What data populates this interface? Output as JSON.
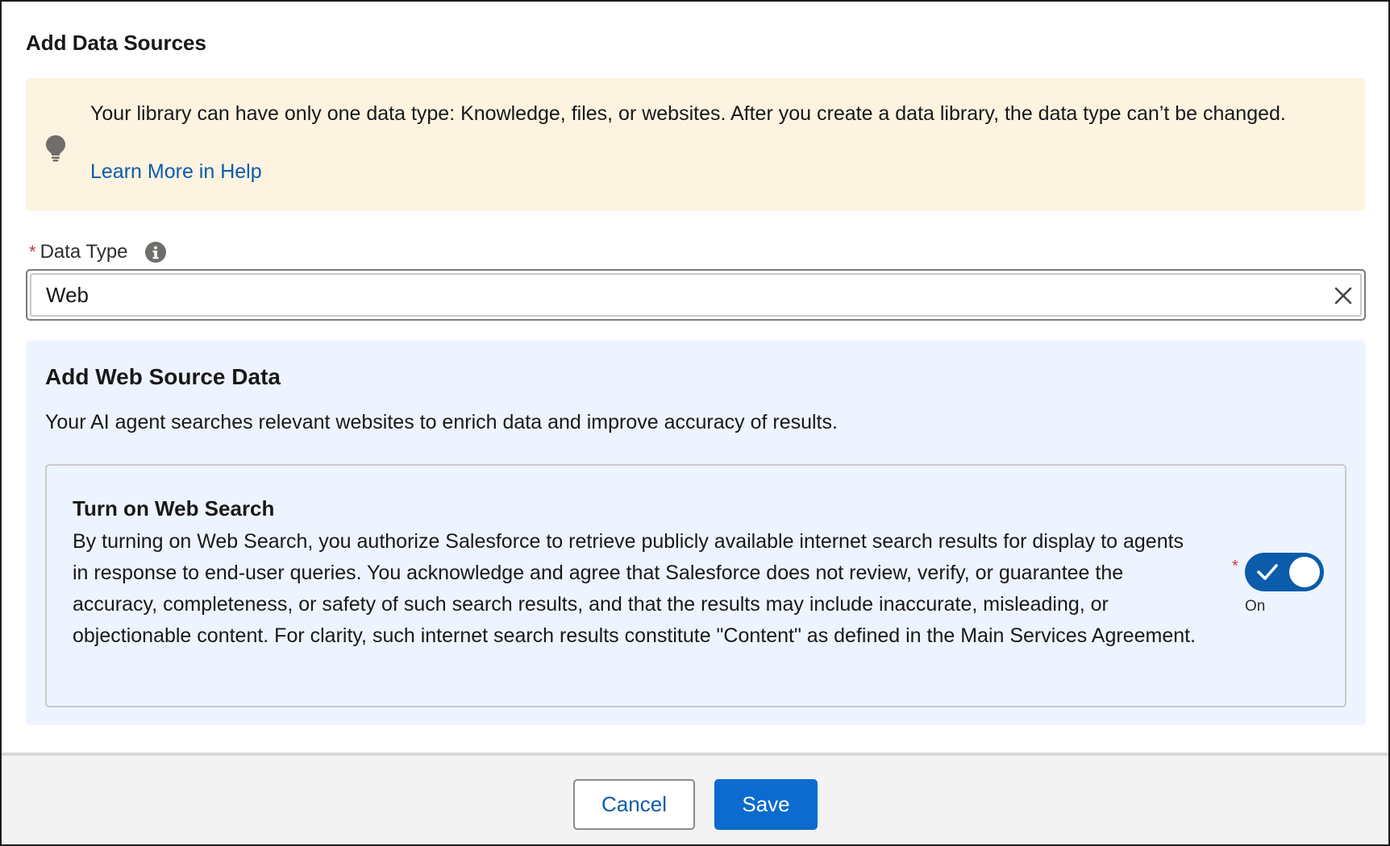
{
  "modal": {
    "title": "Add Data Sources"
  },
  "notice": {
    "icon": "lightbulb-icon",
    "message": "Your library can have only one data type: Knowledge, files, or websites. After you create a data library, the data type can’t be changed.",
    "help_link": "Learn More in Help"
  },
  "data_type": {
    "required_marker": "*",
    "label": "Data Type",
    "info_icon": "info-icon",
    "value": "Web",
    "clear_icon": "close-icon"
  },
  "web_source": {
    "heading": "Add Web Source Data",
    "description": "Your AI agent searches relevant websites to enrich data and improve accuracy of results.",
    "web_search": {
      "title": "Turn on Web Search",
      "body": "By turning on Web Search, you authorize Salesforce to retrieve publicly available internet search results for display to agents in response to end-user queries. You acknowledge and agree that Salesforce does not review, verify, or guarantee the accuracy, completeness, or safety of such search results, and that the results may include inaccurate, misleading, or objectionable content. For clarity, such internet search results constitute \"Content\" as defined in the Main Services Agreement.",
      "required_marker": "*",
      "toggle_checked": true,
      "toggle_state_label": "On"
    }
  },
  "footer": {
    "cancel_label": "Cancel",
    "save_label": "Save"
  },
  "colors": {
    "brand_blue": "#0b5cab",
    "notice_bg": "#fcf3e1",
    "panel_bg": "#eef4ff",
    "required_red": "#c23934"
  }
}
